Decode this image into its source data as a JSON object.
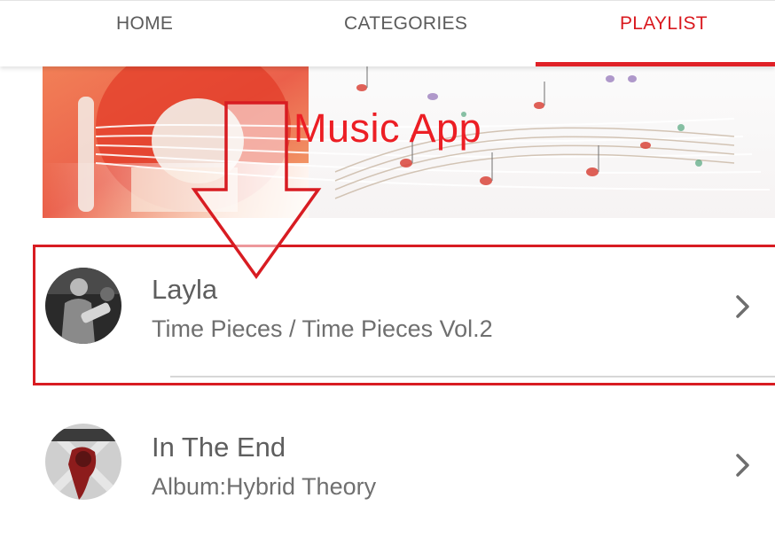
{
  "tabs": [
    {
      "label": "HOME",
      "active": false
    },
    {
      "label": "CATEGORIES",
      "active": false
    },
    {
      "label": "PLAYLIST",
      "active": true
    }
  ],
  "banner": {
    "title": "Music App"
  },
  "playlist": [
    {
      "title": "Layla",
      "subtitle": "Time Pieces / Time Pieces Vol.2",
      "icon": "chevron-right-icon"
    },
    {
      "title": "In The End",
      "subtitle": "Album:Hybrid Theory",
      "icon": "chevron-right-icon"
    }
  ],
  "colors": {
    "accent": "#e02127",
    "annotation": "#d81c22",
    "text_primary": "#5e5e5e",
    "text_secondary": "#6f6f6f"
  }
}
